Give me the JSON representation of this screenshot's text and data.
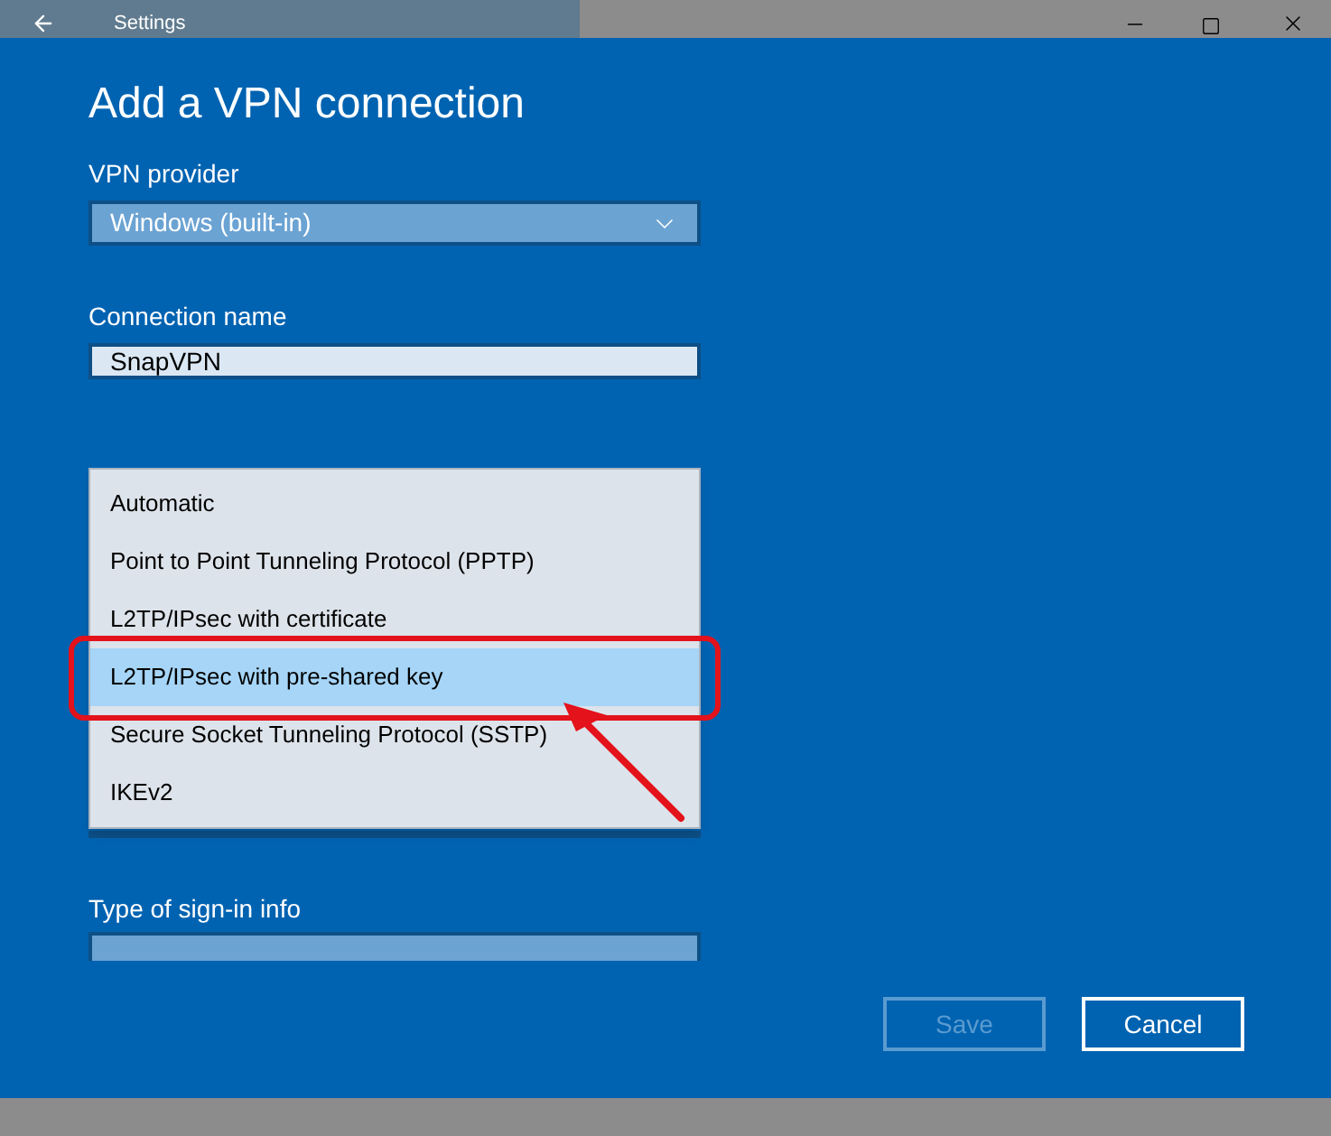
{
  "window": {
    "title": "Settings"
  },
  "page_title": "Add a VPN connection",
  "vpn_provider": {
    "label": "VPN provider",
    "value": "Windows (built-in)"
  },
  "connection_name": {
    "label": "Connection name",
    "value": "SnapVPN"
  },
  "vpn_type_menu": {
    "items": [
      {
        "label": "Automatic",
        "selected": false
      },
      {
        "label": "Point to Point Tunneling Protocol (PPTP)",
        "selected": false
      },
      {
        "label": "L2TP/IPsec with certificate",
        "selected": false
      },
      {
        "label": "L2TP/IPsec with pre-shared key",
        "selected": true
      },
      {
        "label": "Secure Socket Tunneling Protocol (SSTP)",
        "selected": false
      },
      {
        "label": "IKEv2",
        "selected": false
      }
    ]
  },
  "sign_in_info": {
    "label": "Type of sign-in info"
  },
  "buttons": [
    {
      "label": "Save",
      "disabled": true
    },
    {
      "label": "Cancel",
      "disabled": false
    }
  ]
}
